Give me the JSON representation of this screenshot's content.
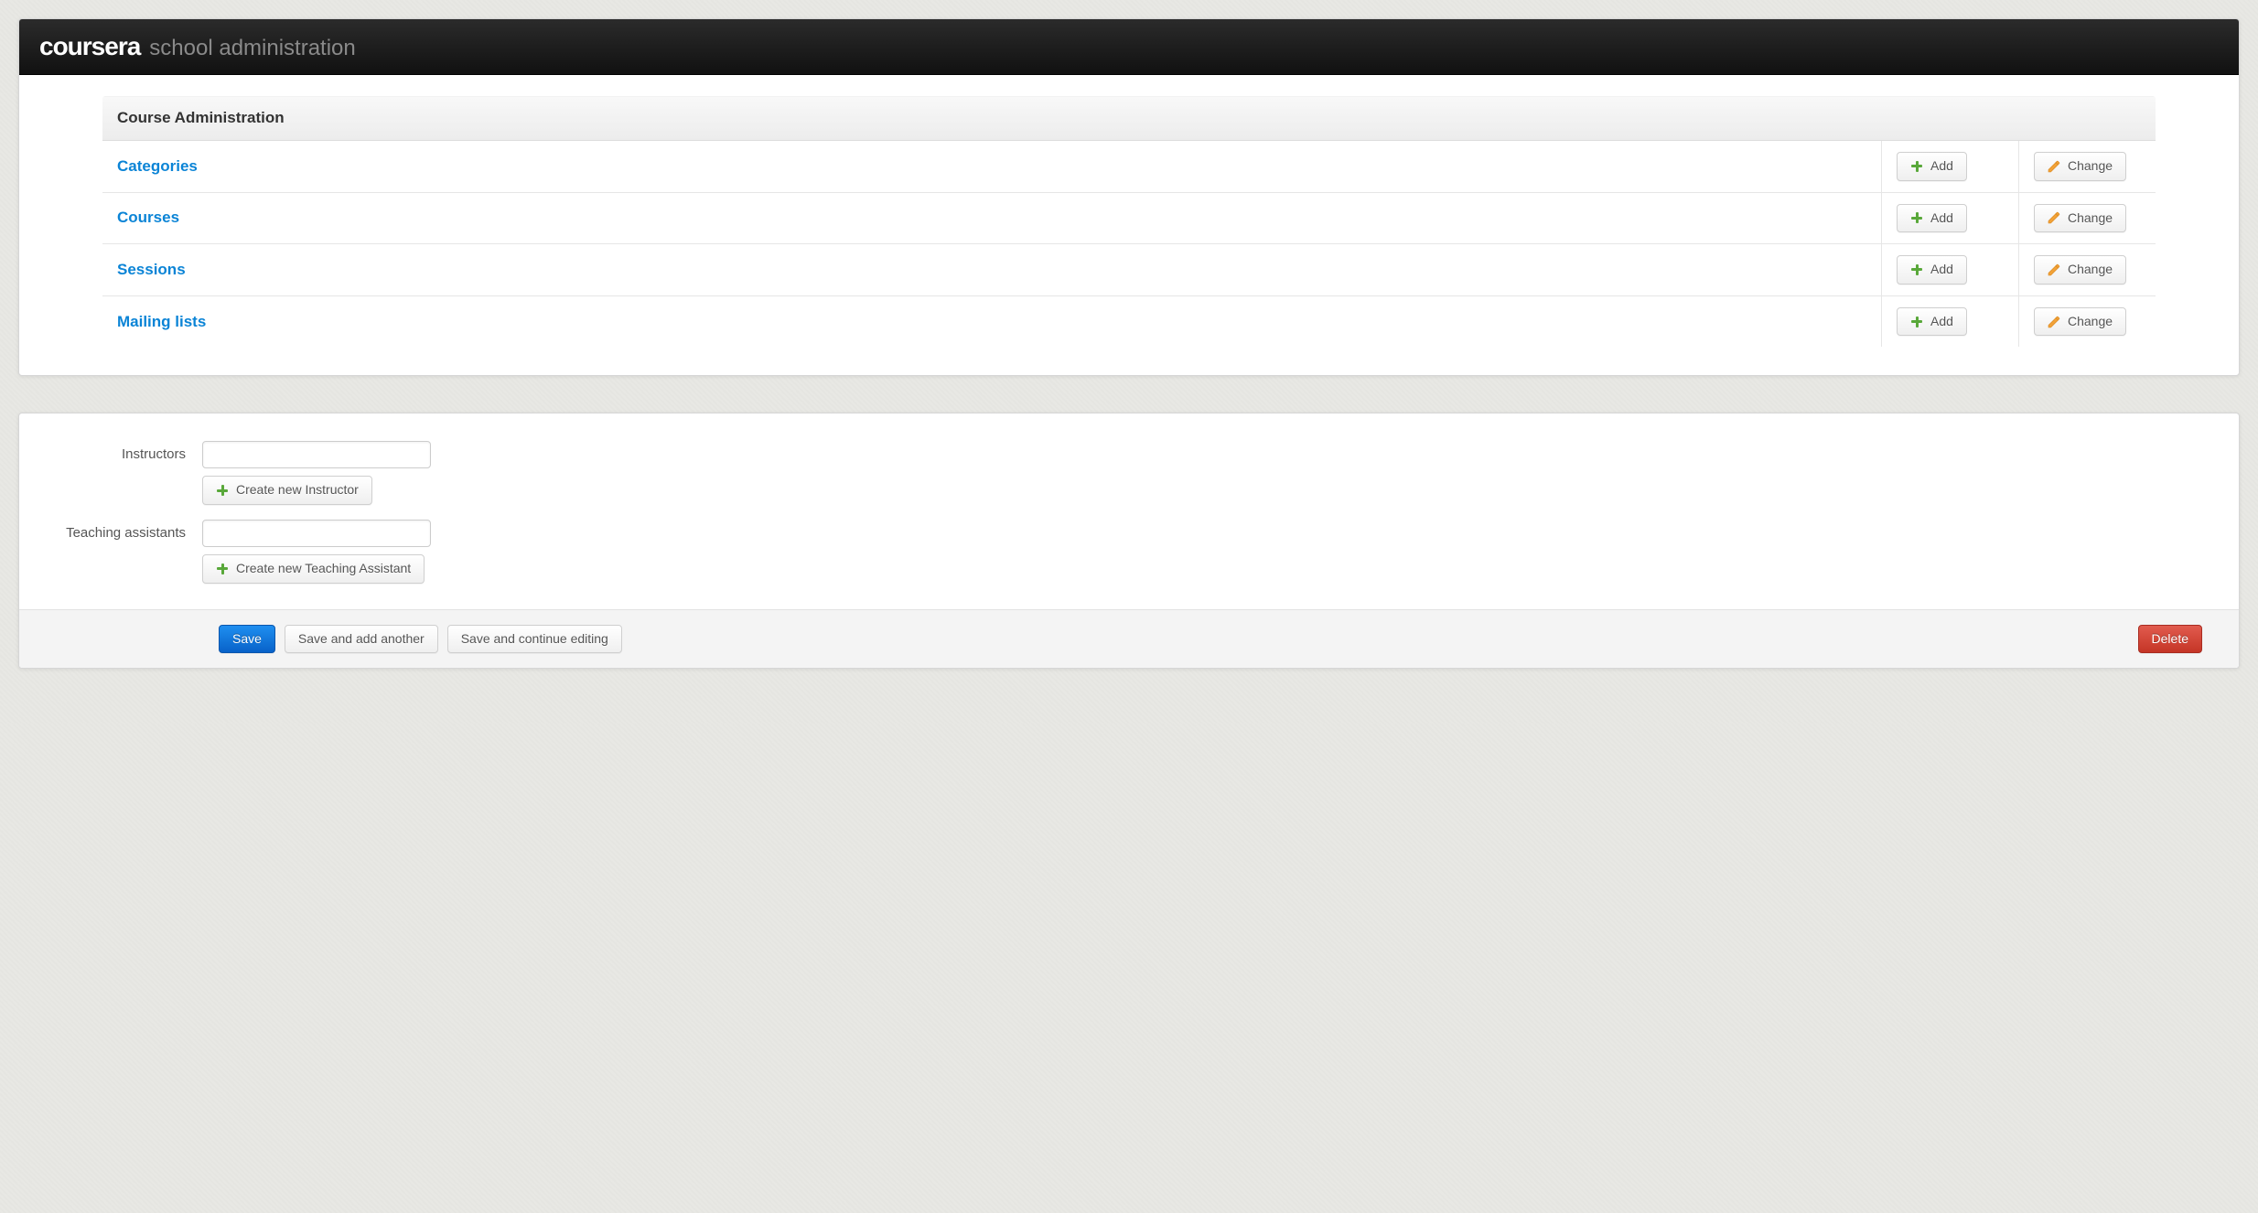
{
  "header": {
    "brand": "coursera",
    "subtitle": "school administration"
  },
  "adminTable": {
    "title": "Course Administration",
    "addLabel": "Add",
    "changeLabel": "Change",
    "rows": [
      {
        "name": "Categories"
      },
      {
        "name": "Courses"
      },
      {
        "name": "Sessions"
      },
      {
        "name": "Mailing lists"
      }
    ]
  },
  "form": {
    "instructors": {
      "label": "Instructors",
      "value": "",
      "createLabel": "Create new Instructor"
    },
    "tas": {
      "label": "Teaching assistants",
      "value": "",
      "createLabel": "Create new Teaching Assistant"
    },
    "actions": {
      "save": "Save",
      "saveAddAnother": "Save and add another",
      "saveContinue": "Save and continue editing",
      "delete": "Delete"
    }
  }
}
